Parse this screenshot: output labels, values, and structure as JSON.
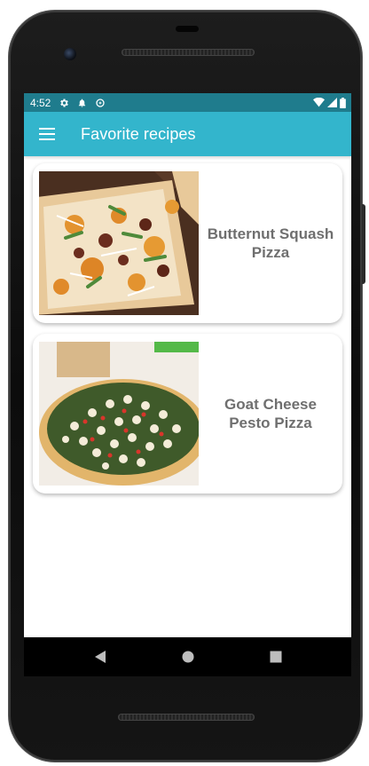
{
  "status_bar": {
    "time": "4:52",
    "icons": [
      "gear-icon",
      "bell-icon",
      "data-saver-icon",
      "wifi-icon",
      "signal-icon",
      "battery-icon"
    ]
  },
  "app_bar": {
    "title": "Favorite recipes",
    "menu_icon": "hamburger-menu-icon"
  },
  "recipes": [
    {
      "name": "Butternut Squash Pizza",
      "image": "butternut-squash-pizza-photo"
    },
    {
      "name": "Goat Cheese Pesto Pizza",
      "image": "goat-cheese-pesto-pizza-photo"
    }
  ],
  "nav_bar": {
    "icons": [
      "back-icon",
      "home-icon",
      "recents-icon"
    ]
  },
  "colors": {
    "status_bar": "#1f7c8d",
    "app_bar": "#33b5cc",
    "card_title": "#6f6f6f",
    "nav_bar": "#000000"
  }
}
